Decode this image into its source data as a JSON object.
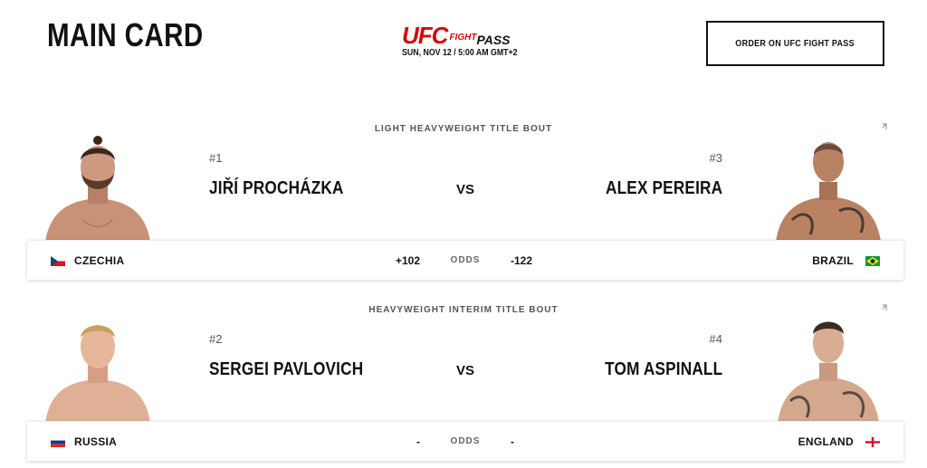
{
  "header": {
    "title": "MAIN CARD",
    "brand_primary": "UFC",
    "brand_fight": "FIGHT",
    "brand_pass": "PASS",
    "event_date": "SUN, NOV 12 / 5:00 AM GMT+2",
    "order_label": "ORDER ON UFC FIGHT PASS"
  },
  "colors": {
    "brand_red": "#d20a0a"
  },
  "bouts": [
    {
      "weight_class": "LIGHT HEAVYWEIGHT TITLE BOUT",
      "expand_icon": "expand-arrows-icon",
      "odds_label": "ODDS",
      "red": {
        "rank": "#1",
        "name": "JIŘÍ PROCHÁZKA",
        "country": "CZECHIA",
        "flag": "czechia-flag-icon",
        "odds": "+102"
      },
      "blue": {
        "rank": "#3",
        "name": "ALEX PEREIRA",
        "country": "BRAZIL",
        "flag": "brazil-flag-icon",
        "odds": "-122"
      },
      "vs": "VS"
    },
    {
      "weight_class": "HEAVYWEIGHT INTERIM TITLE BOUT",
      "expand_icon": "expand-arrows-icon",
      "odds_label": "ODDS",
      "red": {
        "rank": "#2",
        "name": "SERGEI PAVLOVICH",
        "country": "RUSSIA",
        "flag": "russia-flag-icon",
        "odds": "-"
      },
      "blue": {
        "rank": "#4",
        "name": "TOM ASPINALL",
        "country": "ENGLAND",
        "flag": "england-flag-icon",
        "odds": "-"
      },
      "vs": "VS"
    }
  ]
}
